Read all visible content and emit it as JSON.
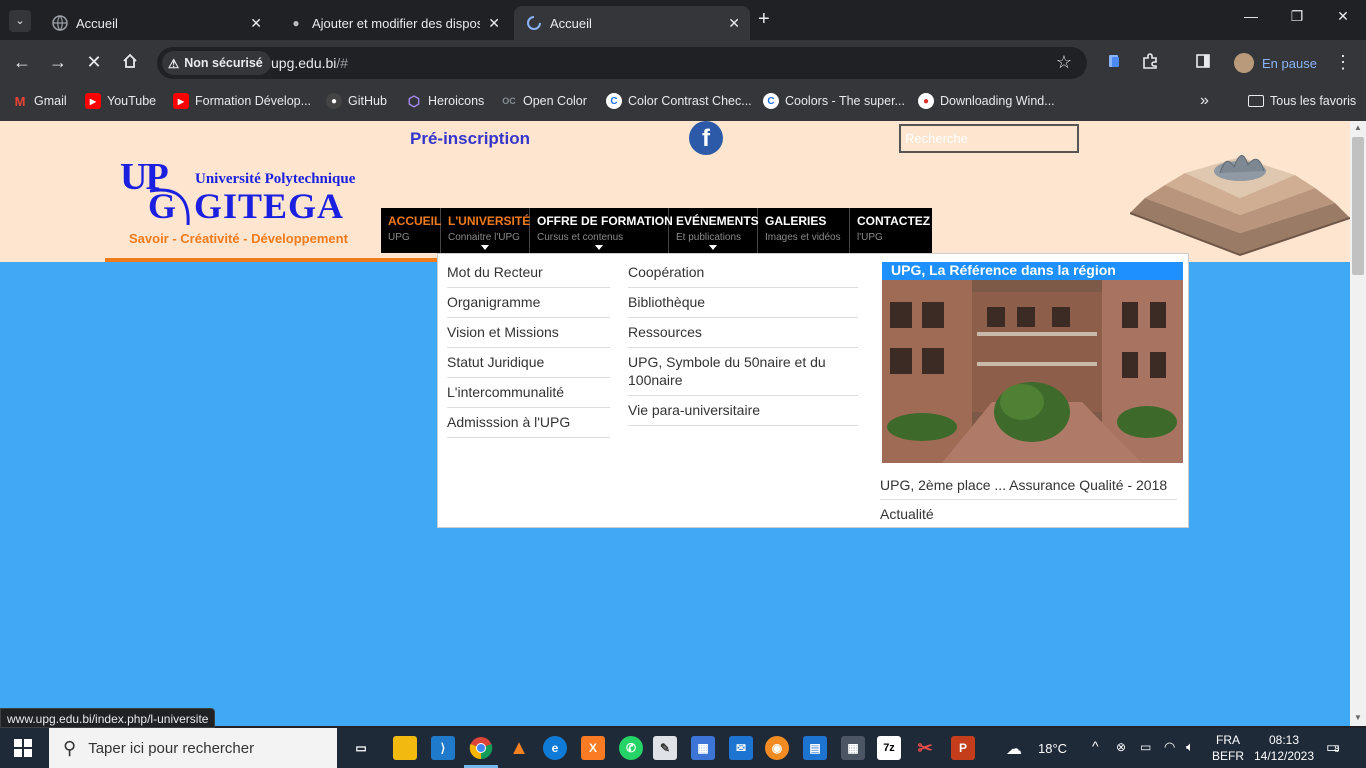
{
  "browser": {
    "tabs": [
      {
        "title": "Accueil",
        "active": false
      },
      {
        "title": "Ajouter et modifier des disposit",
        "active": false
      },
      {
        "title": "Accueil",
        "active": true
      }
    ],
    "security_label": "Non sécurisé",
    "url_host": "upg.edu.bi",
    "url_path": "/#",
    "profile_status": "En pause",
    "bookmarks": [
      {
        "label": "Gmail",
        "icon": "gmail-icon",
        "color": "#ea4335"
      },
      {
        "label": "YouTube",
        "icon": "youtube-icon",
        "color": "#ff0000"
      },
      {
        "label": "Formation Dévelop...",
        "icon": "youtube-icon",
        "color": "#ff0000"
      },
      {
        "label": "GitHub",
        "icon": "github-icon",
        "color": "#444444"
      },
      {
        "label": "Heroicons",
        "icon": "heroicons-icon",
        "color": "#8b5cf6"
      },
      {
        "label": "Open Color",
        "icon": "opencolor-icon",
        "color": "#868e96"
      },
      {
        "label": "Color Contrast Chec...",
        "icon": "contrast-icon",
        "color": "#1a73e8"
      },
      {
        "label": "Coolors - The super...",
        "icon": "coolors-icon",
        "color": "#1a73e8"
      },
      {
        "label": "Downloading Wind...",
        "icon": "download-icon",
        "color": "#d93025"
      }
    ],
    "all_bookmarks_label": "Tous les favoris",
    "status_url": "www.upg.edu.bi/index.php/l-universite"
  },
  "site": {
    "preinscription": "Pré-inscription",
    "facebook_glyph": "f",
    "search_placeholder": "Recherche",
    "logo": {
      "up": "UP",
      "g": "G",
      "university": "Université Polytechnique",
      "city": "GITEGA",
      "tagline": "Savoir - Créativité - Développement"
    },
    "nav": [
      {
        "label": "ACCUEIL",
        "sub": "UPG",
        "highlight": true,
        "caret": false
      },
      {
        "label": "L'UNIVERSITÉ",
        "sub": "Connaitre l'UPG",
        "highlight": true,
        "caret": true
      },
      {
        "label": "OFFRE DE FORMATION",
        "sub": "Cursus et contenus",
        "highlight": false,
        "caret": true
      },
      {
        "label": "EVÉNEMENTS",
        "sub": "Et publications",
        "highlight": false,
        "caret": true
      },
      {
        "label": "GALERIES",
        "sub": "Images et vidéos",
        "highlight": false,
        "caret": false
      },
      {
        "label": "CONTACTEZ",
        "sub": "l'UPG",
        "highlight": false,
        "caret": false
      }
    ],
    "dropdown": {
      "col1": [
        "Mot du Recteur",
        "Organigramme",
        "Vision et Missions",
        "Statut Juridique",
        "L'intercommunalité",
        "Admisssion à l'UPG"
      ],
      "col2": [
        "Coopération",
        "Bibliothèque",
        "Ressources",
        "UPG, Symbole du 50naire et du 100naire",
        "Vie para-universitaire"
      ],
      "featured_title": "UPG, La Référence dans la région",
      "news": [
        "UPG, 2ème place ... Assurance Qualité - 2018",
        "Actualité"
      ]
    },
    "colors": {
      "accent_orange": "#f07b1c",
      "page_blue": "#3fa9f5",
      "header_bg": "#fde5cf",
      "logo_blue": "#1b1fe0"
    }
  },
  "taskbar": {
    "search_placeholder": "Taper ici pour rechercher",
    "weather": "18°C",
    "lang": "FRA",
    "layout": "BEFR",
    "time": "08:13",
    "date": "14/12/2023",
    "notifications": "8"
  }
}
